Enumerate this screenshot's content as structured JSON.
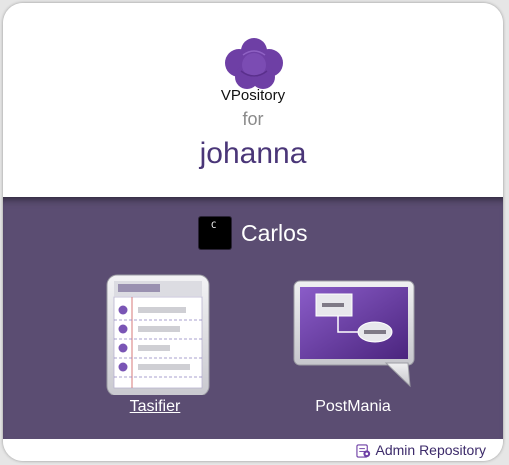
{
  "header": {
    "app_name": "VPository",
    "for_label": "for",
    "user_name": "johanna"
  },
  "account": {
    "icon_glyph": "C",
    "name": "Carlos"
  },
  "apps": [
    {
      "label": "Tasifier",
      "icon": "task-list-icon"
    },
    {
      "label": "PostMania",
      "icon": "diagram-presentation-icon"
    }
  ],
  "footer": {
    "admin_label": "Admin Repository",
    "admin_icon": "admin-repository-icon"
  },
  "colors": {
    "brand_purple": "#6e3fa5",
    "panel_background": "#5b4d72",
    "username_text": "#4a3678"
  }
}
